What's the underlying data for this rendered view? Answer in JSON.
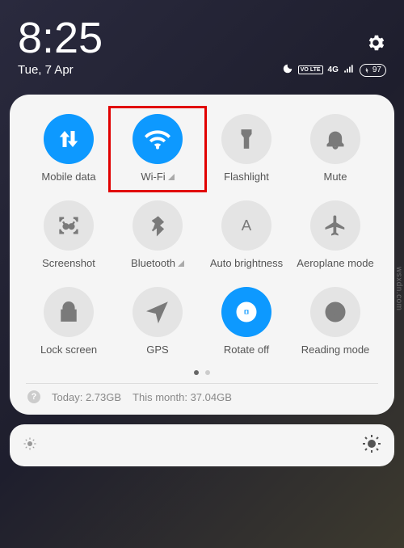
{
  "status": {
    "time": "8:25",
    "date": "Tue, 7 Apr",
    "lte": "VO LTE",
    "signal": "4G",
    "battery": "97"
  },
  "tiles": [
    {
      "label": "Mobile data",
      "active": true,
      "icon": "data",
      "expand": false
    },
    {
      "label": "Wi-Fi",
      "active": true,
      "icon": "wifi",
      "expand": true
    },
    {
      "label": "Flashlight",
      "active": false,
      "icon": "flashlight",
      "expand": false
    },
    {
      "label": "Mute",
      "active": false,
      "icon": "bell",
      "expand": false
    },
    {
      "label": "Screenshot",
      "active": false,
      "icon": "screenshot",
      "expand": false
    },
    {
      "label": "Bluetooth",
      "active": false,
      "icon": "bluetooth",
      "expand": true
    },
    {
      "label": "Auto brightness",
      "active": false,
      "icon": "autobright",
      "expand": false
    },
    {
      "label": "Aeroplane mode",
      "active": false,
      "icon": "airplane",
      "expand": false
    },
    {
      "label": "Lock screen",
      "active": false,
      "icon": "lock",
      "expand": false
    },
    {
      "label": "GPS",
      "active": false,
      "icon": "gps",
      "expand": false
    },
    {
      "label": "Rotate off",
      "active": true,
      "icon": "rotate",
      "expand": false
    },
    {
      "label": "Reading mode",
      "active": false,
      "icon": "reading",
      "expand": false
    }
  ],
  "usage": {
    "today_label": "Today:",
    "today_value": "2.73GB",
    "month_label": "This month:",
    "month_value": "37.04GB"
  },
  "watermark": "wsxdn.com",
  "highlighted_tile_index": 1
}
